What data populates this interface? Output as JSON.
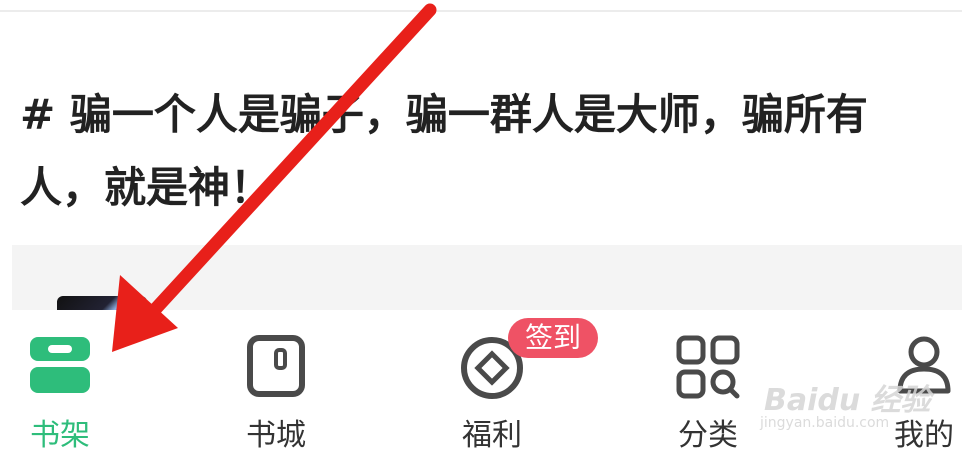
{
  "article": {
    "title": "# 骗一个人是骗子，骗一群人是大师，骗所有人，就是神！"
  },
  "nav": {
    "items": [
      {
        "label": "书架",
        "icon": "bookshelf-icon",
        "active": true
      },
      {
        "label": "书城",
        "icon": "book-store-icon",
        "active": false
      },
      {
        "label": "福利",
        "icon": "coin-icon",
        "active": false,
        "badge": "签到"
      },
      {
        "label": "分类",
        "icon": "category-grid-icon",
        "active": false
      },
      {
        "label": "我的",
        "icon": "profile-icon",
        "active": false
      }
    ]
  },
  "watermark": {
    "main": "Baidu 经验",
    "sub": "jingyan.baidu.com"
  },
  "colors": {
    "accent": "#2ebd7b",
    "badge": "#ef5265",
    "arrow": "#e8201a",
    "icon": "#4a4a4a"
  }
}
